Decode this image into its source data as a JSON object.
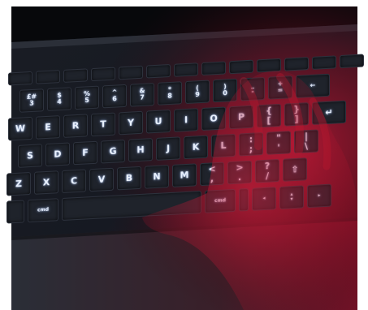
{
  "keyboard": {
    "function_row": [
      "",
      "",
      "",
      "",
      "",
      "",
      "",
      "",
      "",
      "",
      "",
      "",
      ""
    ],
    "number_row": [
      "£#\n3",
      "$\n4",
      "%\n5",
      "^\n6",
      "&\n7",
      "*\n8",
      "(\n9",
      ")\n0",
      "_\n-",
      "+\n=",
      "←"
    ],
    "qwerty_row": [
      "W",
      "E",
      "R",
      "T",
      "Y",
      "U",
      "I",
      "O",
      "P",
      "{\n[",
      "}\n]",
      "↵"
    ],
    "home_row": [
      "S",
      "D",
      "F",
      "G",
      "H",
      "J",
      "K",
      "L",
      ":\n;",
      "\"\n'",
      "|\n\\"
    ],
    "bottom_row": [
      "Z",
      "X",
      "C",
      "V",
      "B",
      "N",
      "M",
      "<\n,",
      ">\n.",
      "?\n/",
      "⇧"
    ],
    "space_row": [
      "",
      "cmd",
      "",
      "cmd",
      "",
      "◂",
      "▴\n▾",
      "▸"
    ]
  },
  "colors": {
    "backlight": "#e9f1ff",
    "key": "#1f232b",
    "ambient_red": "#c8102e",
    "shadow": "#0b0c10"
  }
}
